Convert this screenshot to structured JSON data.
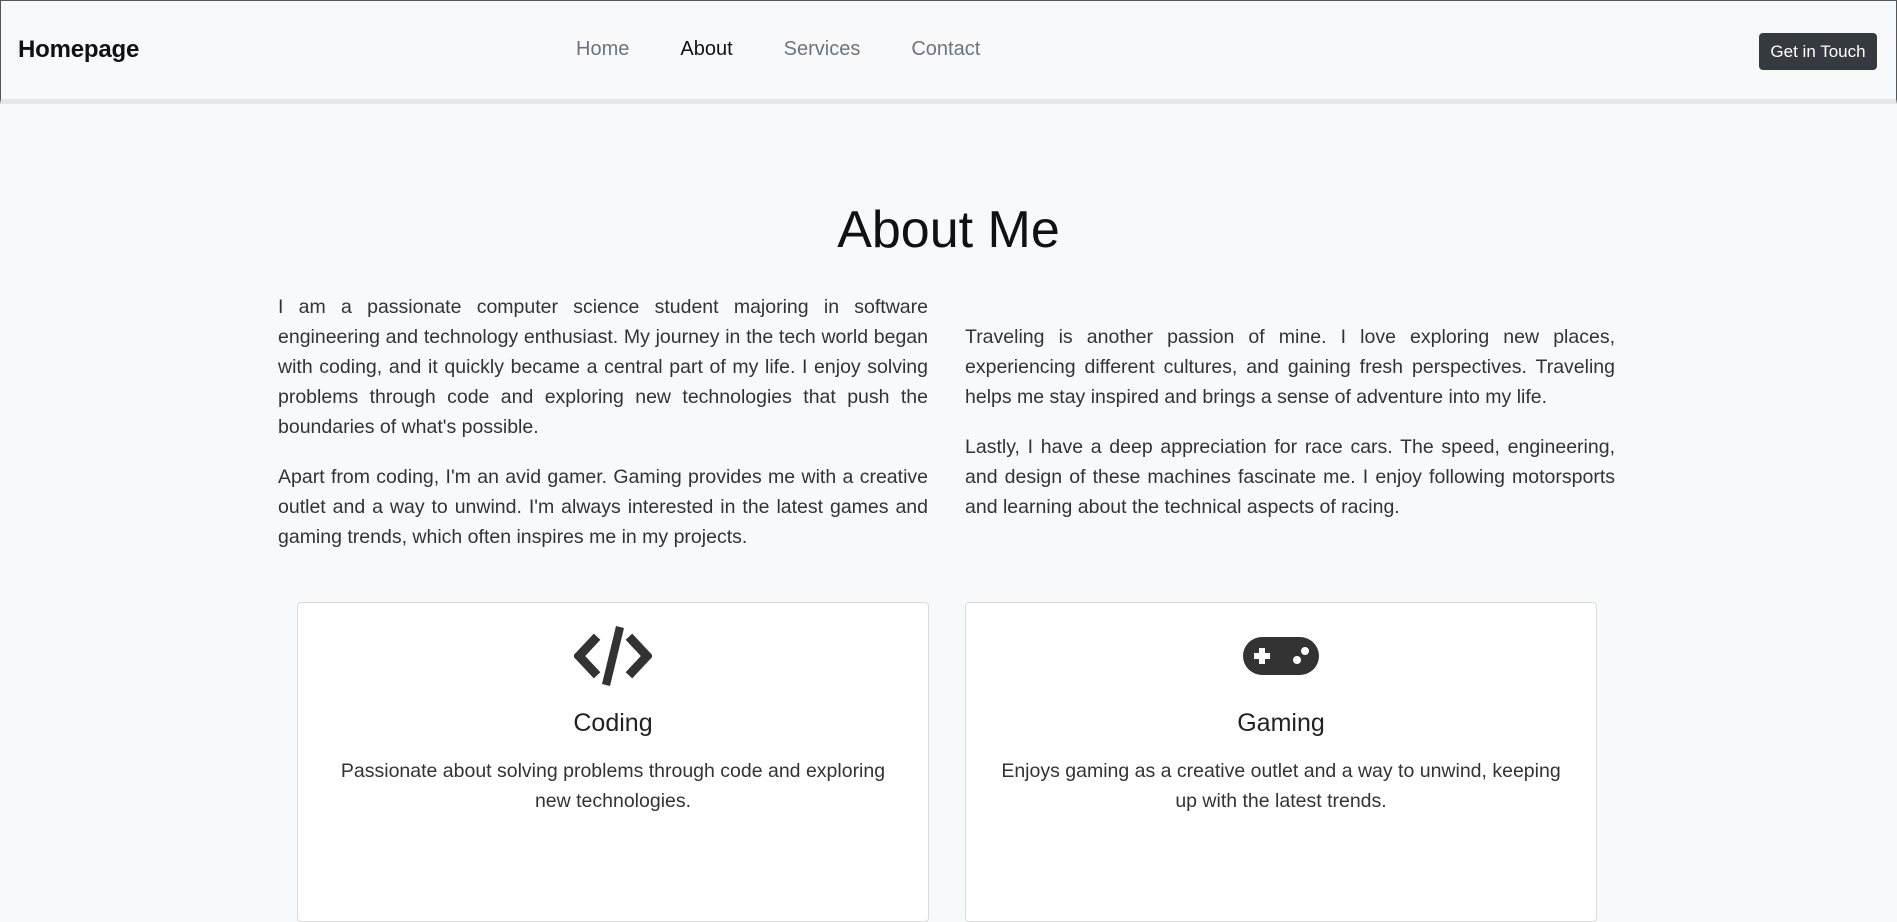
{
  "nav": {
    "brand": "Homepage",
    "links": [
      "Home",
      "About",
      "Services",
      "Contact"
    ],
    "active": "About",
    "cta_label": "Get in Touch"
  },
  "main": {
    "title": "About Me",
    "left_paragraphs": [
      "I am a passionate computer science student majoring in software engineering and technology enthusiast. My journey in the tech world began with coding, and it quickly became a central part of my life. I enjoy solving problems through code and exploring new technologies that push the boundaries of what's possible.",
      "Apart from coding, I'm an avid gamer. Gaming provides me with a creative outlet and a way to unwind. I'm always interested in the latest games and gaming trends, which often inspires me in my projects."
    ],
    "right_paragraphs": [
      "Traveling is another passion of mine. I love exploring new places, experiencing different cultures, and gaining fresh perspectives. Traveling helps me stay inspired and brings a sense of adventure into my life.",
      "Lastly, I have a deep appreciation for race cars. The speed, engineering, and design of these machines fascinate me. I enjoy following motorsports and learning about the technical aspects of racing."
    ]
  },
  "cards": [
    {
      "icon": "code-icon",
      "title": "Coding",
      "text": "Passionate about solving problems through code and exploring new technologies."
    },
    {
      "icon": "gamepad-icon",
      "title": "Gaming",
      "text": "Enjoys gaming as a creative outlet and a way to unwind, keeping up with the latest trends."
    }
  ],
  "colors": {
    "background": "#f8f9fa",
    "navbar_border": "#e7e8ea",
    "cta_background": "#343a40",
    "nav_inactive": "#6c757d",
    "icon": "#333333"
  }
}
